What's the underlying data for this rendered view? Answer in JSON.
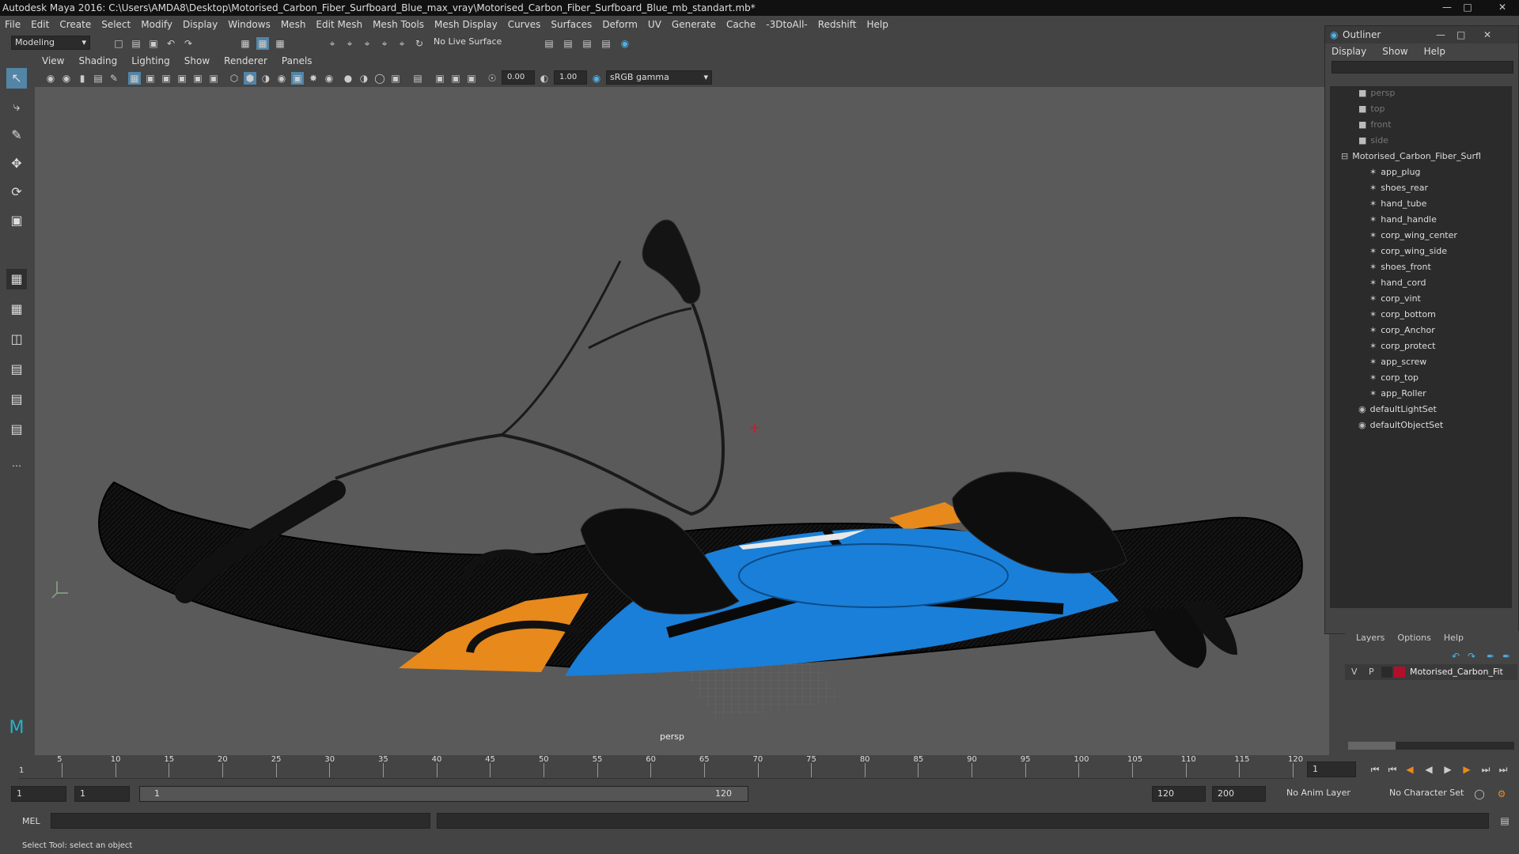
{
  "window": {
    "title": "Autodesk Maya 2016: C:\\Users\\AMDA8\\Desktop\\Motorised_Carbon_Fiber_Surfboard_Blue_max_vray\\Motorised_Carbon_Fiber_Surfboard_Blue_mb_standart.mb*"
  },
  "menubar": [
    "File",
    "Edit",
    "Create",
    "Select",
    "Modify",
    "Display",
    "Windows",
    "Mesh",
    "Edit Mesh",
    "Mesh Tools",
    "Mesh Display",
    "Curves",
    "Surfaces",
    "Deform",
    "UV",
    "Generate",
    "Cache",
    "-3DtoAll-",
    "Redshift",
    "Help"
  ],
  "shelf": {
    "mode": "Modeling",
    "live_surface": "No Live Surface"
  },
  "panel": {
    "menus": [
      "View",
      "Shading",
      "Lighting",
      "Show",
      "Renderer",
      "Panels"
    ],
    "exposure": "0.00",
    "gamma": "1.00",
    "color_space": "sRGB gamma"
  },
  "viewport": {
    "camera_label": "persp"
  },
  "outliner": {
    "title": "Outliner",
    "menus": [
      "Display",
      "Show",
      "Help"
    ],
    "cameras": [
      "persp",
      "top",
      "front",
      "side"
    ],
    "group": "Motorised_Carbon_Fiber_Surfl",
    "children": [
      "app_plug",
      "shoes_rear",
      "hand_tube",
      "hand_handle",
      "corp_wing_center",
      "corp_wing_side",
      "shoes_front",
      "hand_cord",
      "corp_vint",
      "corp_bottom",
      "corp_Anchor",
      "corp_protect",
      "app_screw",
      "corp_top",
      "app_Roller"
    ],
    "sets": [
      "defaultLightSet",
      "defaultObjectSet"
    ]
  },
  "layers": {
    "menus": [
      "Layers",
      "Options",
      "Help"
    ],
    "v": "V",
    "p": "P",
    "layer_name": "Motorised_Carbon_Fit",
    "layer_color": "#b0102a"
  },
  "timeline": {
    "ticks": [
      "5",
      "10",
      "15",
      "20",
      "25",
      "30",
      "35",
      "40",
      "45",
      "50",
      "55",
      "60",
      "65",
      "70",
      "75",
      "80",
      "85",
      "90",
      "95",
      "100",
      "105",
      "110",
      "115",
      "120"
    ],
    "start_tick": "1",
    "current_frame": "1"
  },
  "range": {
    "start": "1",
    "playback_start": "1",
    "slider_start": "1",
    "slider_end": "120",
    "playback_end": "120",
    "end": "200",
    "anim_layer": "No Anim Layer",
    "char_set": "No Character Set"
  },
  "command": {
    "lang": "MEL"
  },
  "status": {
    "help": "Select Tool: select an object"
  }
}
